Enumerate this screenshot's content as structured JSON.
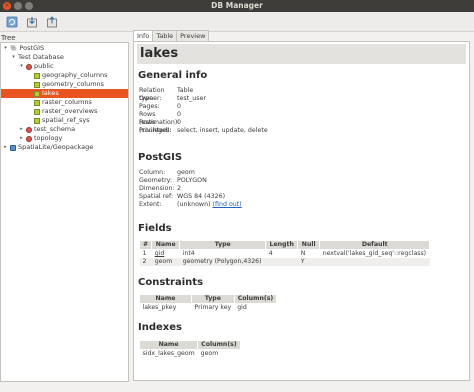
{
  "window": {
    "title": "DB Manager"
  },
  "toolbar": {
    "buttons": [
      "refresh-icon",
      "import-layer-icon",
      "export-file-icon"
    ]
  },
  "tree": {
    "header": "Tree",
    "nodes": [
      {
        "label": "PostGIS",
        "indent": 0,
        "arrow": "▾",
        "icon": "postgis"
      },
      {
        "label": "Test Database",
        "indent": 1,
        "arrow": "▾",
        "icon": "none"
      },
      {
        "label": "public",
        "indent": 2,
        "arrow": "▾",
        "icon": "schema"
      },
      {
        "label": "geography_columns",
        "indent": 3,
        "arrow": "",
        "icon": "table"
      },
      {
        "label": "geometry_columns",
        "indent": 3,
        "arrow": "",
        "icon": "table"
      },
      {
        "label": "lakes",
        "indent": 3,
        "arrow": "",
        "icon": "table",
        "selected": true
      },
      {
        "label": "raster_columns",
        "indent": 3,
        "arrow": "",
        "icon": "table"
      },
      {
        "label": "raster_overviews",
        "indent": 3,
        "arrow": "",
        "icon": "table"
      },
      {
        "label": "spatial_ref_sys",
        "indent": 3,
        "arrow": "",
        "icon": "table"
      },
      {
        "label": "test_schema",
        "indent": 2,
        "arrow": "▸",
        "icon": "schema"
      },
      {
        "label": "topology",
        "indent": 2,
        "arrow": "▸",
        "icon": "schema"
      },
      {
        "label": "SpatiaLite/Geopackage",
        "indent": 0,
        "arrow": "▸",
        "icon": "spatialite"
      }
    ]
  },
  "tabs": [
    {
      "label": "Info",
      "active": true
    },
    {
      "label": "Table",
      "active": false
    },
    {
      "label": "Preview",
      "active": false
    }
  ],
  "info": {
    "title": "lakes",
    "general": {
      "heading": "General info",
      "rows": [
        {
          "k": "Relation type:",
          "v": "Table"
        },
        {
          "k": "Owner:",
          "v": "test_user"
        },
        {
          "k": "Pages:",
          "v": "0"
        },
        {
          "k": "Rows (estimation):",
          "v": "0"
        },
        {
          "k": "Rows (counted):",
          "v": "0"
        },
        {
          "k": "Privileges:",
          "v": "select, insert, update, delete"
        }
      ]
    },
    "postgis": {
      "heading": "PostGIS",
      "rows": [
        {
          "k": "Column:",
          "v": "geom"
        },
        {
          "k": "Geometry:",
          "v": "POLYGON"
        },
        {
          "k": "Dimension:",
          "v": "2"
        },
        {
          "k": "Spatial ref:",
          "v": "WGS 84 (4326)"
        },
        {
          "k": "Extent:",
          "v": "(unknown)",
          "link": "(find out)"
        }
      ]
    },
    "fields": {
      "heading": "Fields",
      "columns": [
        "#",
        "Name",
        "Type",
        "Length",
        "Null",
        "Default"
      ],
      "rows": [
        [
          "1",
          "gid",
          "int4",
          "4",
          "N",
          "nextval('lakes_gid_seq'::regclass)"
        ],
        [
          "2",
          "geom",
          "geometry (Polygon,4326)",
          "",
          "Y",
          ""
        ]
      ]
    },
    "constraints": {
      "heading": "Constraints",
      "columns": [
        "Name",
        "Type",
        "Column(s)"
      ],
      "rows": [
        [
          "lakes_pkey",
          "Primary key",
          "gid"
        ]
      ]
    },
    "indexes": {
      "heading": "Indexes",
      "columns": [
        "Name",
        "Column(s)"
      ],
      "rows": [
        [
          "sidx_lakes_geom",
          "geom"
        ]
      ]
    }
  }
}
